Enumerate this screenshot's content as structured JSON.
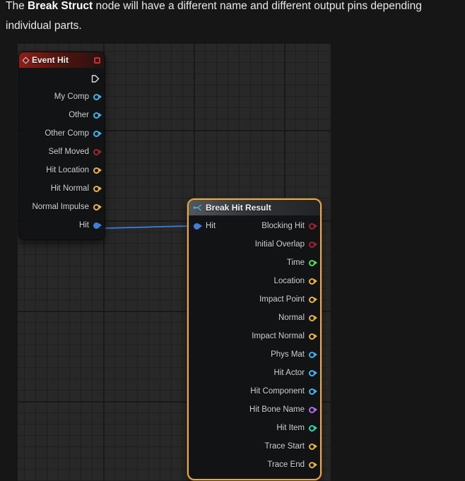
{
  "intro": {
    "pre": "The ",
    "bold_term": "Break Struct",
    "post": " node will have a different name and different output pins depending",
    "line2": "individual parts."
  },
  "colors": {
    "exec": "#DEDEDE",
    "object": "#3CB4E8",
    "bool": "#9E2430",
    "vector": "#E8B43A",
    "float": "#4FD94F",
    "int": "#2BD9A8",
    "name": "#B46AE8",
    "struct_hit": "#3E7FD9",
    "wire": "#3E7FD9",
    "selection_outline": "#ECA93F",
    "event_header_red": "#8E1F17"
  },
  "graph": {
    "event_hit": {
      "title": "Event Hit",
      "pins": [
        {
          "label": "My Comp",
          "type": "object"
        },
        {
          "label": "Other",
          "type": "object"
        },
        {
          "label": "Other Comp",
          "type": "object"
        },
        {
          "label": "Self Moved",
          "type": "bool"
        },
        {
          "label": "Hit Location",
          "type": "vector"
        },
        {
          "label": "Hit Normal",
          "type": "vector"
        },
        {
          "label": "Normal Impulse",
          "type": "vector"
        },
        {
          "label": "Hit",
          "type": "struct_hit"
        }
      ]
    },
    "break_hit_result": {
      "title": "Break Hit Result",
      "input": {
        "label": "Hit",
        "type": "struct_hit"
      },
      "outputs": [
        {
          "label": "Blocking Hit",
          "type": "bool"
        },
        {
          "label": "Initial Overlap",
          "type": "bool"
        },
        {
          "label": "Time",
          "type": "float"
        },
        {
          "label": "Location",
          "type": "vector"
        },
        {
          "label": "Impact Point",
          "type": "vector"
        },
        {
          "label": "Normal",
          "type": "vector"
        },
        {
          "label": "Impact Normal",
          "type": "vector"
        },
        {
          "label": "Phys Mat",
          "type": "object"
        },
        {
          "label": "Hit Actor",
          "type": "object"
        },
        {
          "label": "Hit Component",
          "type": "object"
        },
        {
          "label": "Hit Bone Name",
          "type": "name"
        },
        {
          "label": "Hit Item",
          "type": "int"
        },
        {
          "label": "Trace Start",
          "type": "vector"
        },
        {
          "label": "Trace End",
          "type": "vector"
        }
      ]
    }
  }
}
